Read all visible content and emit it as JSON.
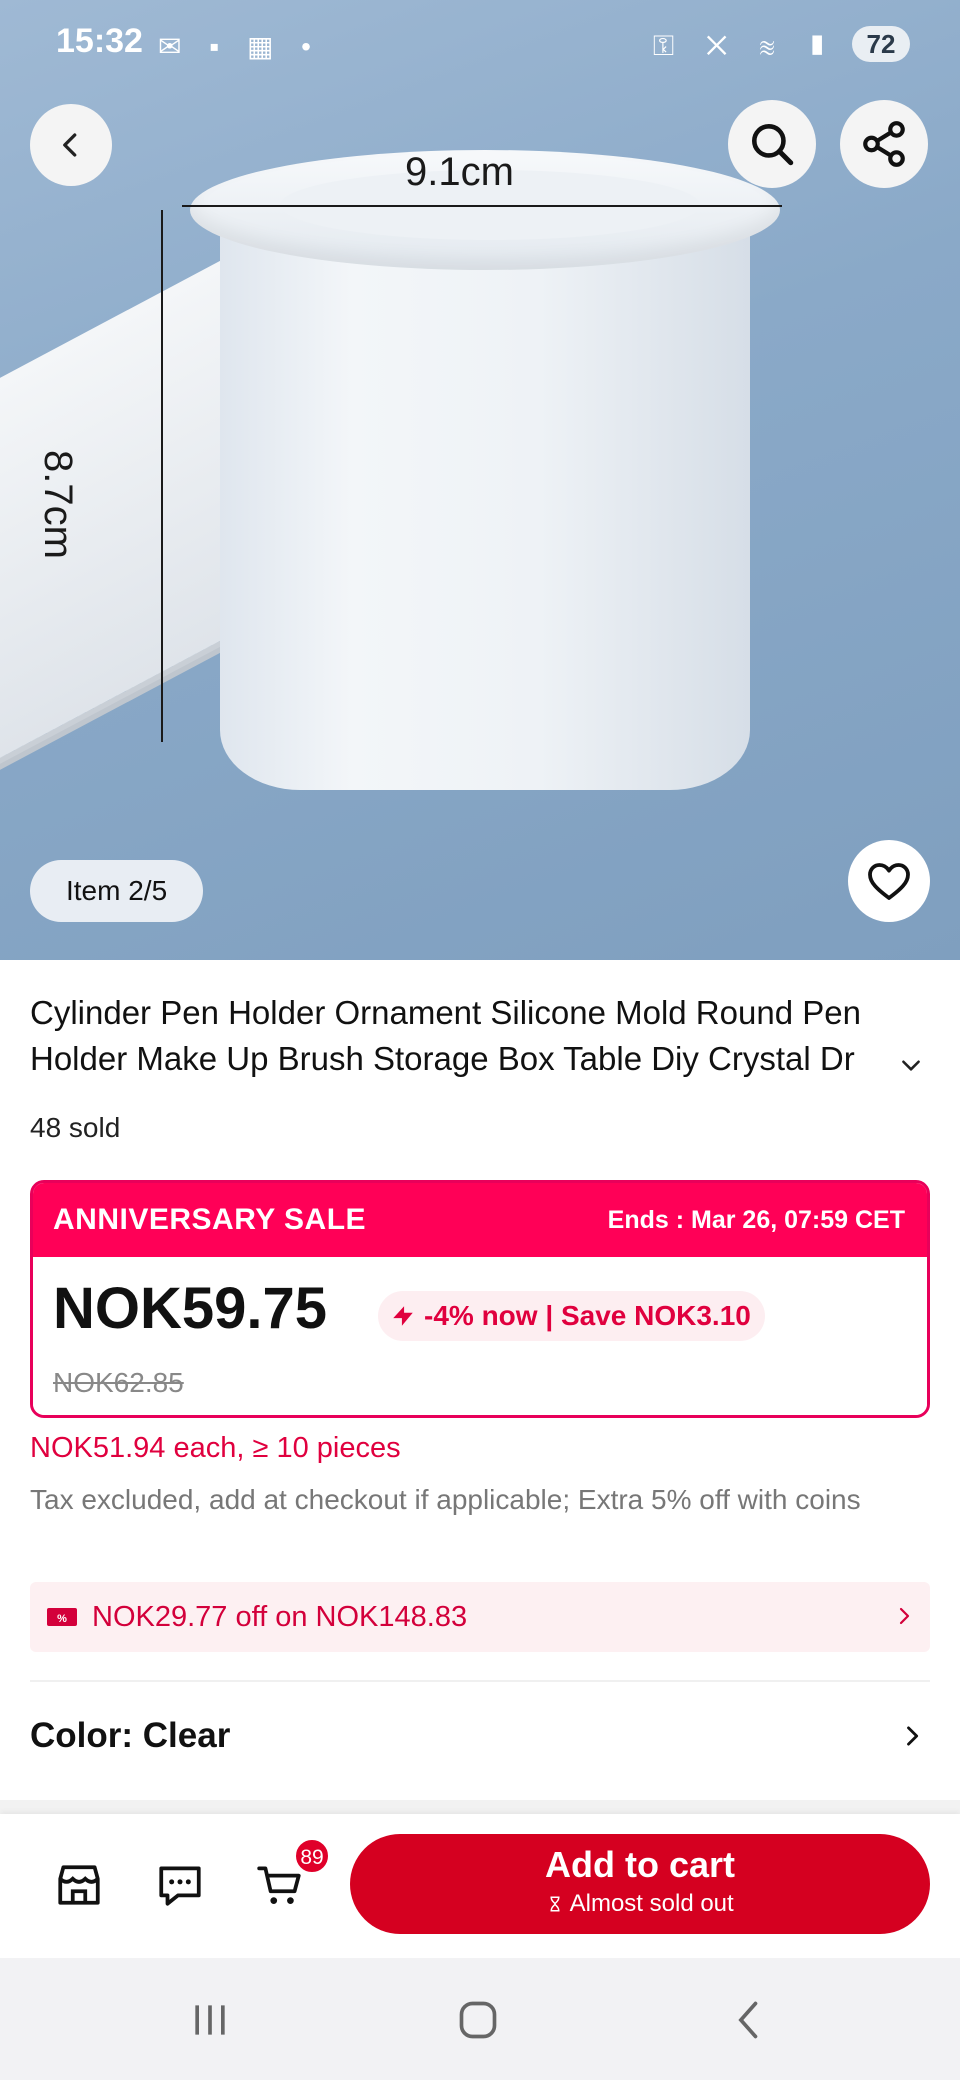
{
  "status_bar": {
    "time": "15:32",
    "battery": "72"
  },
  "gallery": {
    "dimension_width": "9.1cm",
    "dimension_height": "8.7cm",
    "pager": "Item 2/5"
  },
  "product": {
    "title": "Cylinder Pen Holder Ornament Silicone Mold Round Pen Holder Make Up Brush Storage Box Table Diy Crystal Dr",
    "sold": "48 sold"
  },
  "sale": {
    "title": "ANNIVERSARY SALE",
    "ends": "Ends :  Mar 26, 07:59 CET",
    "price": "NOK59.75",
    "discount": "-4% now | Save NOK3.10",
    "original_price": "NOK62.85",
    "bulk_price": "NOK51.94 each, ≥ 10 pieces",
    "tax_note": "Tax excluded, add at checkout if applicable; Extra 5% off with coins"
  },
  "coupon": {
    "text": "NOK29.77 off on NOK148.83"
  },
  "color": {
    "label": "Color: Clear"
  },
  "action_bar": {
    "cart_count": "89",
    "add_to_cart": "Add to cart",
    "stock_note": "Almost sold out"
  },
  "colors": {
    "sale_red": "#ff0057",
    "button_red": "#d50020",
    "text_red": "#e0003e"
  }
}
